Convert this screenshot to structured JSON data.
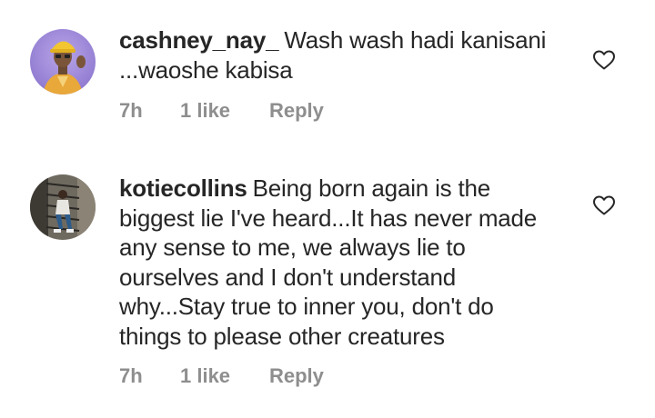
{
  "comments": [
    {
      "username": "cashney_nay_",
      "text": "Wash wash hadi kanisani ...waoshe kabisa",
      "time": "7h",
      "likes": "1 like",
      "reply_label": "Reply",
      "like_icon": "heart-outline-icon"
    },
    {
      "username": "kotiecollins",
      "text": "Being born again is the biggest lie I've heard...It has never made any sense to me,  we always lie to ourselves and I don't understand why...Stay true to inner you, don't do things to please other creatures",
      "time": "7h",
      "likes": "1 like",
      "reply_label": "Reply",
      "like_icon": "heart-outline-icon"
    }
  ],
  "colors": {
    "text": "#262626",
    "meta": "#8e8e8e",
    "background": "#ffffff"
  }
}
